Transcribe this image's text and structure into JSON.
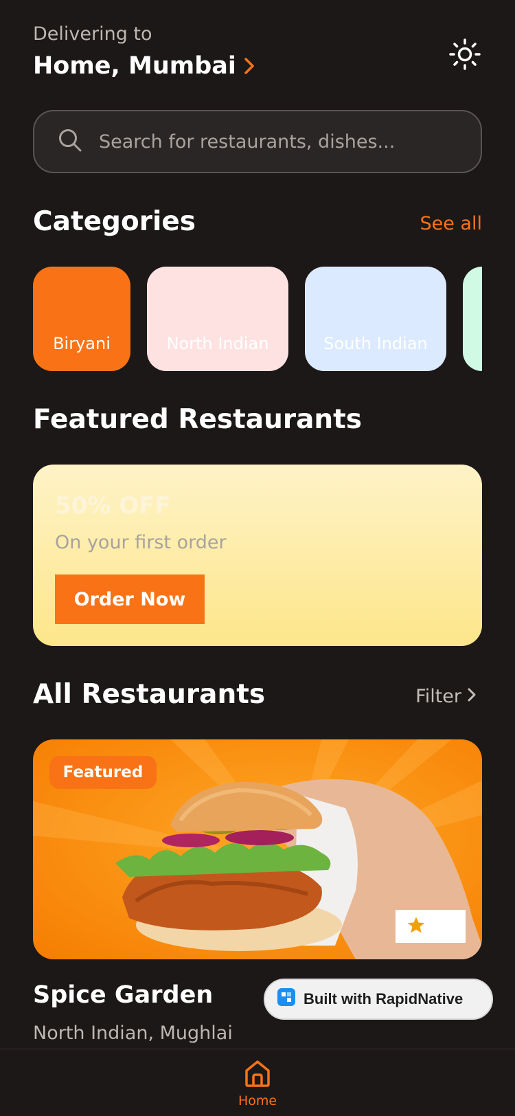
{
  "header": {
    "delivering_label": "Delivering to",
    "location": "Home, Mumbai",
    "theme_icon": "sun-icon"
  },
  "search": {
    "placeholder": "Search for restaurants, dishes...",
    "value": ""
  },
  "categories": {
    "title": "Categories",
    "see_all": "See all",
    "items": [
      {
        "label": "Biryani",
        "color": "#f97316"
      },
      {
        "label": "North Indian",
        "color": "#fee2e2"
      },
      {
        "label": "South Indian",
        "color": "#dbeafe"
      },
      {
        "label": "",
        "color": "#d1fae5"
      }
    ]
  },
  "featured": {
    "title": "Featured Restaurants",
    "promo_title": "50% OFF",
    "promo_subtitle": "On your first order",
    "promo_button": "Order Now"
  },
  "all_restaurants": {
    "title": "All Restaurants",
    "filter": "Filter",
    "card": {
      "badge": "Featured",
      "name": "Spice Garden",
      "cuisine": "North Indian, Mughlai",
      "image_subject": "fried-chicken-burger"
    }
  },
  "built_with": "Built with RapidNative",
  "nav": {
    "home_label": "Home"
  },
  "colors": {
    "accent": "#f97316",
    "background": "#1c1817"
  }
}
